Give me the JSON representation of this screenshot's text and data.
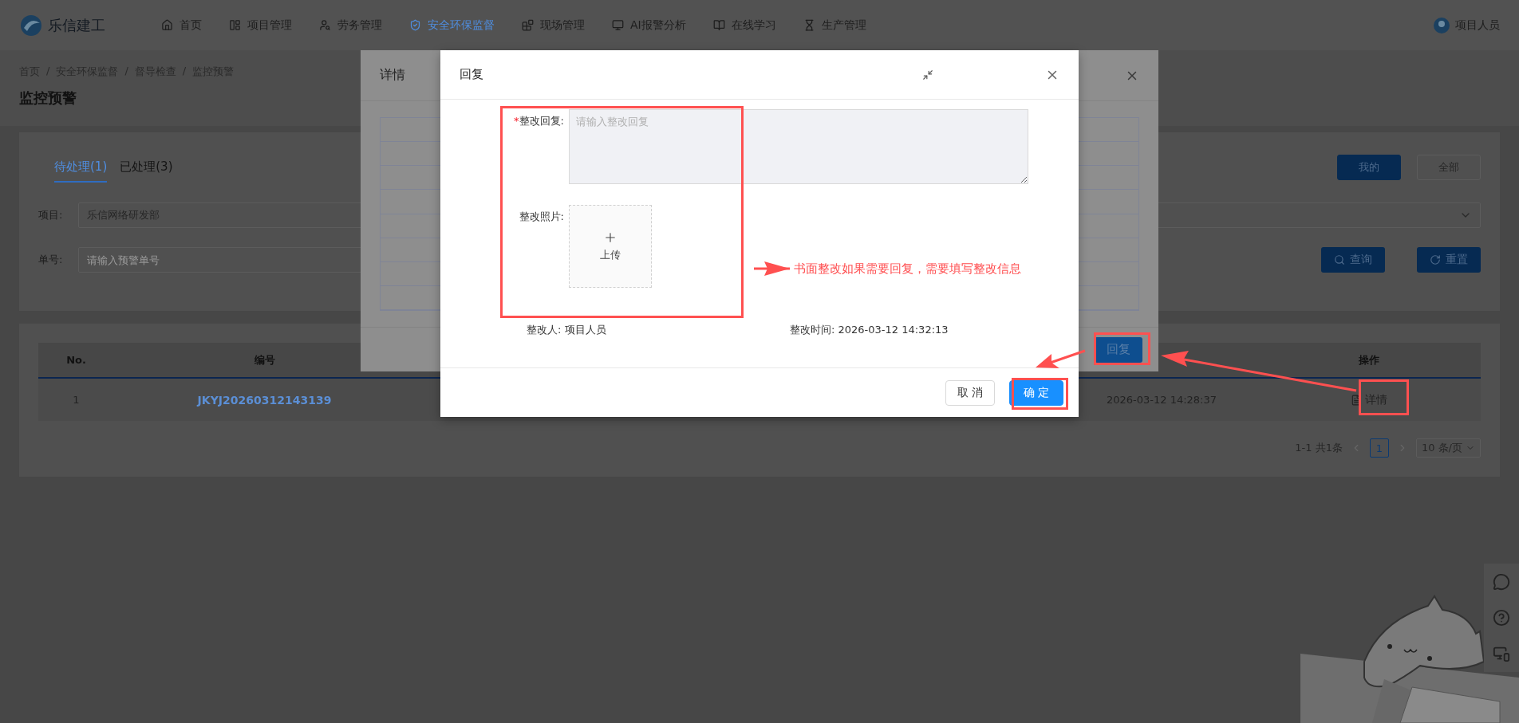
{
  "nav": {
    "brand": "乐信建工",
    "items": [
      {
        "label": "首页",
        "selected": false
      },
      {
        "label": "项目管理",
        "selected": false
      },
      {
        "label": "劳务管理",
        "selected": false
      },
      {
        "label": "安全环保监督",
        "selected": true
      },
      {
        "label": "现场管理",
        "selected": false
      },
      {
        "label": "AI报警分析",
        "selected": false
      },
      {
        "label": "在线学习",
        "selected": false
      },
      {
        "label": "生产管理",
        "selected": false
      }
    ],
    "user": "项目人员"
  },
  "breadcrumb": [
    {
      "label": "首页"
    },
    {
      "separator": "/",
      "label": "安全环保监督"
    },
    {
      "separator": "/",
      "label": "督导检查"
    },
    {
      "separator": "/",
      "label": "监控预警"
    }
  ],
  "page_title": "监控预警",
  "filter": {
    "tabs": [
      {
        "label": "待处理(1)",
        "selected": true
      },
      {
        "label": "已处理(3)",
        "selected": false
      }
    ],
    "scope_buttons": [
      {
        "label": "我的",
        "selected": true
      },
      {
        "label": "全部",
        "selected": false
      }
    ],
    "project": {
      "label": "项目:",
      "value": "乐信网络研发部"
    },
    "number": {
      "label": "单号:",
      "placeholder": "请输入预警单号"
    },
    "buttons": [
      {
        "label": "查询"
      },
      {
        "label": "重置"
      }
    ]
  },
  "table": {
    "header": {
      "no": "No.",
      "code": "编号",
      "action": "操作"
    },
    "rows": [
      {
        "no": "1",
        "code": "JKYJ20260312143139",
        "time": "2026-03-12 14:28:37",
        "action": "详情"
      }
    ]
  },
  "pagination": {
    "total": "1-1 共1条",
    "pages": [
      {
        "label": "1",
        "selected": true
      }
    ],
    "page_size": "10 条/页"
  },
  "detail_dialog": {
    "title": "详情",
    "buttons": [
      "回复"
    ]
  },
  "reply_dialog": {
    "title": "回复",
    "fields": [
      {
        "kind": "textarea",
        "required_mark": "*",
        "label": "整改回复:",
        "placeholder": "请输入整改回复"
      },
      {
        "kind": "upload",
        "label": "整改照片:",
        "upload_text": "上传"
      }
    ],
    "info": [
      "整改人: 项目人员",
      "整改时间: 2026-03-12 14:32:13"
    ],
    "buttons": [
      {
        "label": "取 消",
        "kind": "default"
      },
      {
        "label": "确 定",
        "kind": "primary"
      }
    ]
  },
  "annotation": {
    "note": "书面整改如果需要回复，需要填写整改信息"
  }
}
